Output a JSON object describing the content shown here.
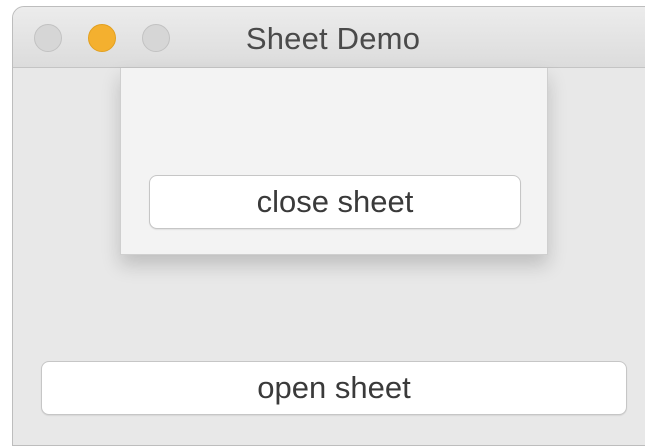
{
  "window": {
    "title": "Sheet Demo"
  },
  "sheet": {
    "close_label": "close sheet"
  },
  "main": {
    "open_label": "open sheet"
  },
  "colors": {
    "minimize_button": "#f4b02f",
    "window_background": "#e8e8e8",
    "sheet_background": "#f3f3f3"
  }
}
